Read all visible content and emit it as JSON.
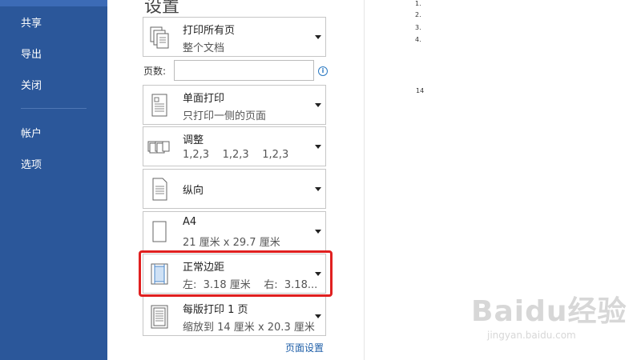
{
  "sidebar": {
    "items": [
      "共享",
      "导出",
      "关闭",
      "帐户",
      "选项"
    ]
  },
  "settings": {
    "title": "设置",
    "print_range": {
      "title": "打印所有页",
      "sub": "整个文档"
    },
    "pages": {
      "label": "页数:",
      "value": ""
    },
    "sides": {
      "title": "单面打印",
      "sub": "只打印一侧的页面"
    },
    "collate": {
      "title": "调整",
      "sub": "1,2,3    1,2,3    1,2,3"
    },
    "orientation": {
      "title": "纵向",
      "sub": ""
    },
    "paper": {
      "title": "A4",
      "sub": "21 厘米 x 29.7 厘米"
    },
    "margins": {
      "title": "正常边距",
      "sub": "左:  3.18 厘米    右:  3.18..."
    },
    "pages_per_sheet": {
      "title": "每版打印 1 页",
      "sub": "缩放到 14 厘米 x 20.3 厘米"
    },
    "page_setup_link": "页面设置"
  },
  "preview": {
    "list": [
      "1.",
      "2.",
      "3.",
      "4."
    ],
    "page_number": "14"
  },
  "watermark": {
    "text": "Baidu经验",
    "sub": "jingyan.baidu.com"
  },
  "colors": {
    "sidebar": "#2b579a",
    "highlight": "#e02020",
    "link": "#1f5fa8"
  }
}
